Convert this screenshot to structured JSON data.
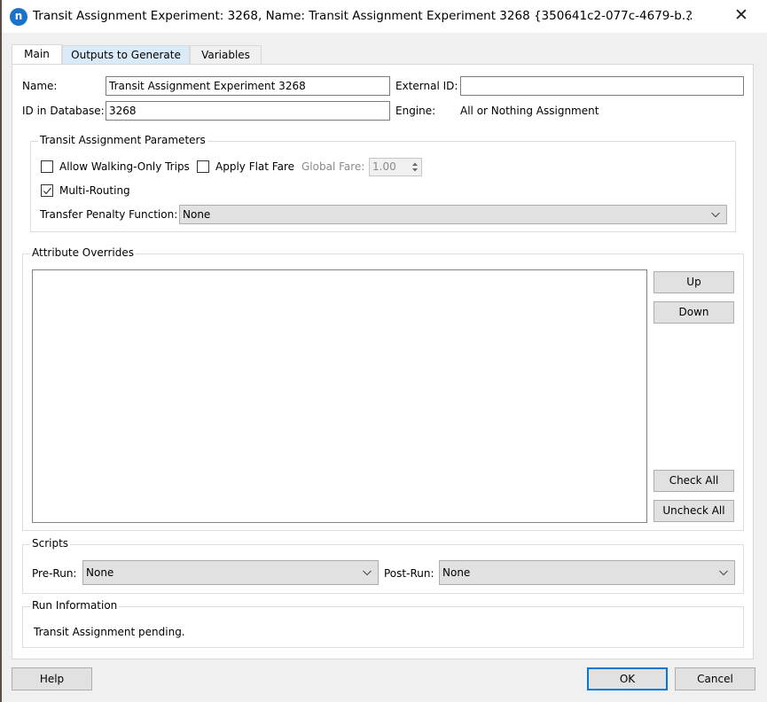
{
  "window": {
    "title": "Transit Assignment Experiment: 3268, Name: Transit Assignment Experiment 3268  {350641c2-077c-4679-b...",
    "app_icon_glyph": "n",
    "help_glyph": "?",
    "close_glyph": "✕"
  },
  "tabs": [
    {
      "label": "Main",
      "active": true
    },
    {
      "label": "Outputs to Generate",
      "active": false
    },
    {
      "label": "Variables",
      "active": false
    }
  ],
  "fields": {
    "name_label": "Name:",
    "name_value": "Transit Assignment Experiment 3268",
    "external_id_label": "External ID:",
    "external_id_value": "",
    "id_label": "ID in Database:",
    "id_value": "3268",
    "engine_label": "Engine:",
    "engine_value": "All or Nothing Assignment"
  },
  "transit_params": {
    "title": "Transit Assignment Parameters",
    "allow_walking_label": "Allow Walking-Only Trips",
    "allow_walking_checked": false,
    "flat_fare_label": "Apply Flat Fare",
    "flat_fare_checked": false,
    "global_fare_label": "Global Fare:",
    "global_fare_value": "1.00",
    "multi_routing_label": "Multi-Routing",
    "multi_routing_checked": true,
    "transfer_penalty_label": "Transfer Penalty Function:",
    "transfer_penalty_value": "None"
  },
  "attribute_overrides": {
    "title": "Attribute Overrides",
    "items": [],
    "up_label": "Up",
    "down_label": "Down",
    "check_all_label": "Check All",
    "uncheck_all_label": "Uncheck All"
  },
  "scripts": {
    "title": "Scripts",
    "pre_run_label": "Pre-Run:",
    "pre_run_value": "None",
    "post_run_label": "Post-Run:",
    "post_run_value": "None"
  },
  "run_info": {
    "title": "Run Information",
    "text": "Transit Assignment pending."
  },
  "footer": {
    "help_label": "Help",
    "ok_label": "OK",
    "cancel_label": "Cancel"
  },
  "colors": {
    "accent": "#0078d7",
    "app_icon": "#1a72c9",
    "active_tab_hover": "#d9eaf9"
  }
}
